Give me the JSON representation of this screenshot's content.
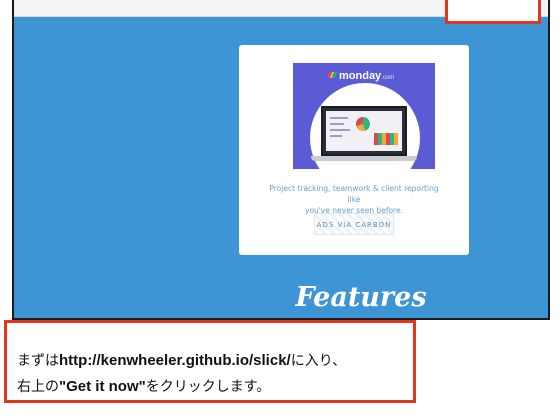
{
  "ad": {
    "brand": "monday",
    "brand_suffix": ".com",
    "text_line1": "Project tracking, teamwork & client reporting like",
    "text_line2": "you've never seen before.",
    "via_label": "ADS VIA CARBON",
    "logo_colors": [
      "#ff3d57",
      "#ffcb00",
      "#00ca72"
    ]
  },
  "features_heading": "Features",
  "caption": {
    "line1_prefix": "まずは",
    "line1_url": "http://kenwheeler.github.io/slick/",
    "line1_suffix": "に入り、",
    "line2_prefix": "右上の",
    "line2_button": "\"Get it now\"",
    "line2_suffix": "をクリックします。"
  },
  "colors": {
    "page_background": "#3d95d6",
    "highlight": "#e5351c",
    "ad_background": "#5b5bd6"
  }
}
